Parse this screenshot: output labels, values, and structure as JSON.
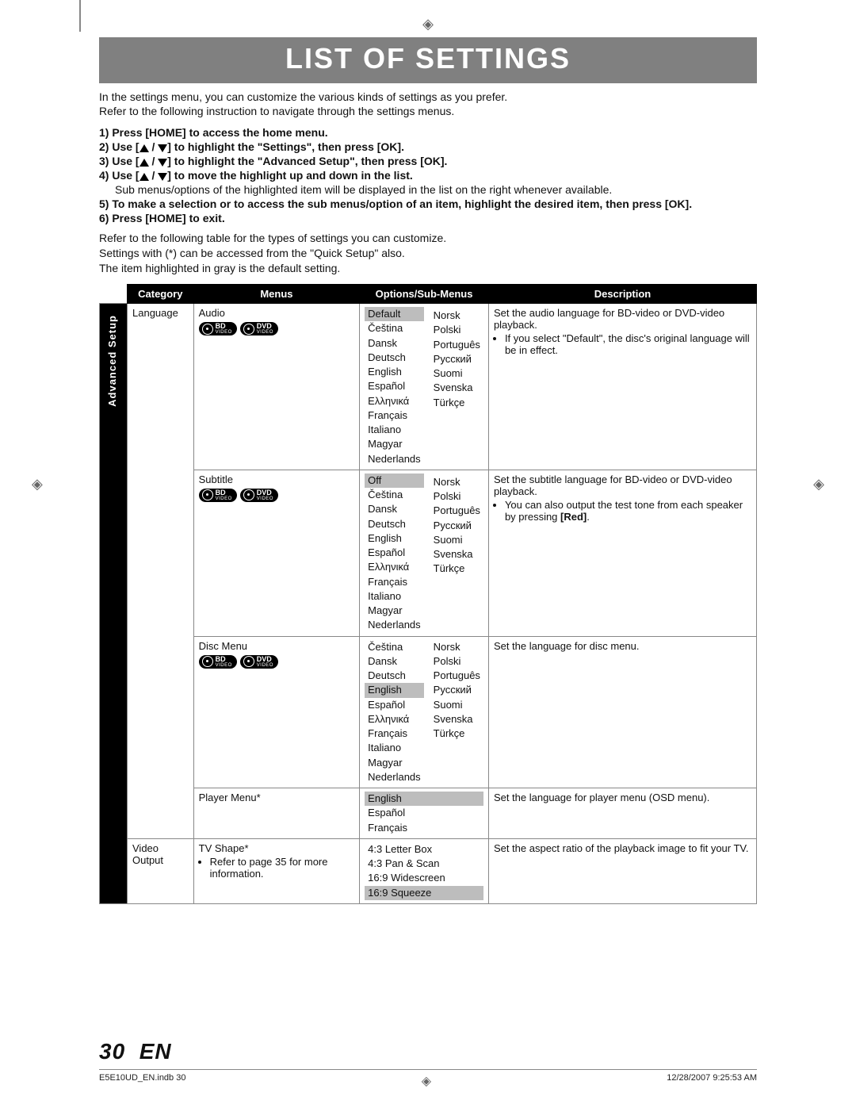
{
  "header": {
    "title": "LIST OF SETTINGS"
  },
  "intro": {
    "line1": "In the settings menu, you can customize the various kinds of settings as you prefer.",
    "line2": "Refer to the following instruction to navigate through the settings menus."
  },
  "steps": {
    "s1": "1) Press [HOME] to access the home menu.",
    "s2a": "2) Use [",
    "s2b": "] to highlight the \"Settings\", then press [OK].",
    "s3a": "3) Use [",
    "s3b": "] to highlight the \"Advanced Setup\", then press [OK].",
    "s4a": "4) Use [",
    "s4b": "] to move the highlight up and down in the list.",
    "s4sub": "Sub menus/options of the highlighted item will be displayed in the list on the right whenever available.",
    "s5": "5) To make a selection or to access the sub menus/option of an item, highlight the desired item, then press [OK].",
    "s6": "6) Press [HOME] to exit."
  },
  "after": {
    "a1": "Refer to the following table for the types of settings you can customize.",
    "a2": "Settings with (*) can be accessed from the \"Quick Setup\" also.",
    "a3": "The item highlighted in gray is the default setting."
  },
  "tableHeaders": {
    "category": "Category",
    "menus": "Menus",
    "options": "Options/Sub-Menus",
    "description": "Description"
  },
  "sideLabel": "Advanced Setup",
  "rows": {
    "audio": {
      "category": "Language",
      "menu": "Audio",
      "optsCol1": [
        "Default",
        "Čeština",
        "Dansk",
        "Deutsch",
        "English",
        "Español",
        "Ελληνικά",
        "Français",
        "Italiano",
        "Magyar",
        "Nederlands"
      ],
      "optsCol2": [
        "",
        "Norsk",
        "Polski",
        "Português",
        "Русский",
        "Suomi",
        "Svenska",
        "Türkçe"
      ],
      "default": "Default",
      "desc": "Set the audio language for BD-video or DVD-video playback.",
      "bullet": "If you select \"Default\", the disc's original language will be in effect."
    },
    "subtitle": {
      "menu": "Subtitle",
      "optsCol1": [
        "Off",
        "Čeština",
        "Dansk",
        "Deutsch",
        "English",
        "Español",
        "Ελληνικά",
        "Français",
        "Italiano",
        "Magyar",
        "Nederlands"
      ],
      "optsCol2": [
        "",
        "Norsk",
        "Polski",
        "Português",
        "Русский",
        "Suomi",
        "Svenska",
        "Türkçe"
      ],
      "default": "Off",
      "desc": "Set the subtitle language for BD-video or DVD-video playback.",
      "bullet1": "You can also output the test tone from each speaker by pressing ",
      "bullet2": "[Red]",
      "bullet3": "."
    },
    "discmenu": {
      "menu": "Disc Menu",
      "optsCol1": [
        "Čeština",
        "Dansk",
        "Deutsch",
        "English",
        "Español",
        "Ελληνικά",
        "Français",
        "Italiano",
        "Magyar",
        "Nederlands"
      ],
      "optsCol2": [
        "Norsk",
        "Polski",
        "Português",
        "Русский",
        "Suomi",
        "Svenska",
        "Türkçe"
      ],
      "default": "English",
      "desc": "Set the language for disc menu."
    },
    "playermenu": {
      "menu": "Player Menu*",
      "opts": [
        "English",
        "Español",
        "Français"
      ],
      "default": "English",
      "desc": "Set the language for player menu (OSD menu)."
    },
    "video": {
      "category": "Video Output",
      "menu": "TV Shape*",
      "menunote": "Refer to page 35 for more information.",
      "opts": [
        "4:3 Letter Box",
        "4:3 Pan & Scan",
        "16:9 Widescreen",
        "16:9 Squeeze"
      ],
      "default": "16:9 Squeeze",
      "desc": "Set the aspect ratio of the playback image to fit your TV."
    }
  },
  "badges": {
    "bd": "BD",
    "dvd": "DVD",
    "video": "VIDEO"
  },
  "footer": {
    "pageNum": "30",
    "lang": "EN",
    "file": "E5E10UD_EN.indb   30",
    "timestamp": "12/28/2007   9:25:53 AM"
  }
}
